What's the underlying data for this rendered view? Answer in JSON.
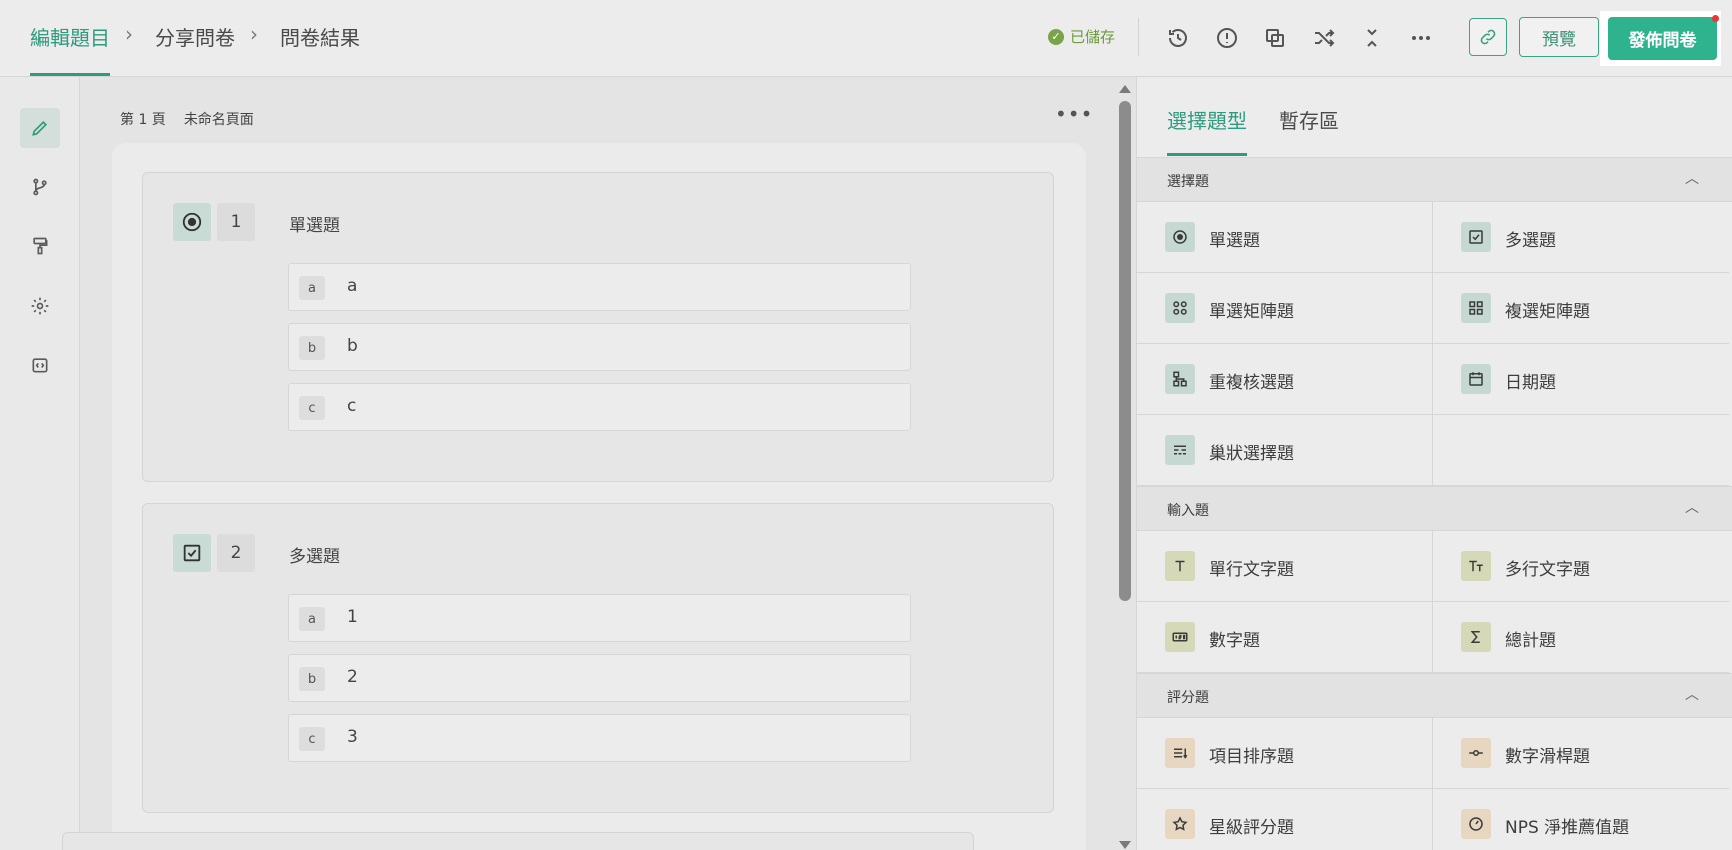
{
  "breadcrumbs": [
    {
      "label": "編輯題目"
    },
    {
      "label": "分享問卷"
    },
    {
      "label": "問卷結果"
    }
  ],
  "status": {
    "saved_label": "已儲存"
  },
  "toolbar": {
    "icons": [
      "history-icon",
      "info-icon",
      "duplicate-icon",
      "shuffle-icon",
      "collapse-icon",
      "more-icon"
    ],
    "preview_label": "預覽",
    "publish_label": "發佈問卷"
  },
  "rail": [
    "edit-icon",
    "logic-branch-icon",
    "paint-roller-icon",
    "gear-icon",
    "code-icon"
  ],
  "page": {
    "number_label": "第 1 頁",
    "name": "未命名頁面"
  },
  "questions": [
    {
      "number": "1",
      "title": "單選題",
      "type_icon": "radio-icon",
      "options": [
        {
          "letter": "a",
          "text": "a"
        },
        {
          "letter": "b",
          "text": "b"
        },
        {
          "letter": "c",
          "text": "c"
        }
      ]
    },
    {
      "number": "2",
      "title": "多選題",
      "type_icon": "checkbox-icon",
      "options": [
        {
          "letter": "a",
          "text": "1"
        },
        {
          "letter": "b",
          "text": "2"
        },
        {
          "letter": "c",
          "text": "3"
        }
      ]
    }
  ],
  "panel": {
    "tabs": [
      {
        "label": "選擇題型"
      },
      {
        "label": "暫存區"
      }
    ],
    "sections": [
      {
        "title": "選擇題",
        "items": [
          {
            "label": "單選題",
            "icon": "radio-icon",
            "tone": "teal"
          },
          {
            "label": "多選題",
            "icon": "checkbox-icon",
            "tone": "teal"
          },
          {
            "label": "單選矩陣題",
            "icon": "matrix-radio-icon",
            "tone": "teal"
          },
          {
            "label": "複選矩陣題",
            "icon": "matrix-check-icon",
            "tone": "teal"
          },
          {
            "label": "重複核選題",
            "icon": "hierarchy-icon",
            "tone": "teal"
          },
          {
            "label": "日期題",
            "icon": "calendar-icon",
            "tone": "teal"
          },
          {
            "label": "巢狀選擇題",
            "icon": "nested-select-icon",
            "tone": "teal"
          }
        ]
      },
      {
        "title": "輸入題",
        "items": [
          {
            "label": "單行文字題",
            "icon": "text-icon",
            "tone": "olive"
          },
          {
            "label": "多行文字題",
            "icon": "text-size-icon",
            "tone": "olive"
          },
          {
            "label": "數字題",
            "icon": "number-icon",
            "tone": "olive"
          },
          {
            "label": "總計題",
            "icon": "sigma-icon",
            "tone": "olive"
          }
        ]
      },
      {
        "title": "評分題",
        "items": [
          {
            "label": "項目排序題",
            "icon": "sort-list-icon",
            "tone": "peach"
          },
          {
            "label": "數字滑桿題",
            "icon": "slider-icon",
            "tone": "peach"
          },
          {
            "label": "星級評分題",
            "icon": "star-icon",
            "tone": "peach"
          },
          {
            "label": "NPS 淨推薦值題",
            "icon": "gauge-icon",
            "tone": "peach"
          }
        ]
      }
    ]
  },
  "colors": {
    "accent": "#2e9a7e",
    "publish": "#2fb38f",
    "saved": "#6c9a3c"
  }
}
